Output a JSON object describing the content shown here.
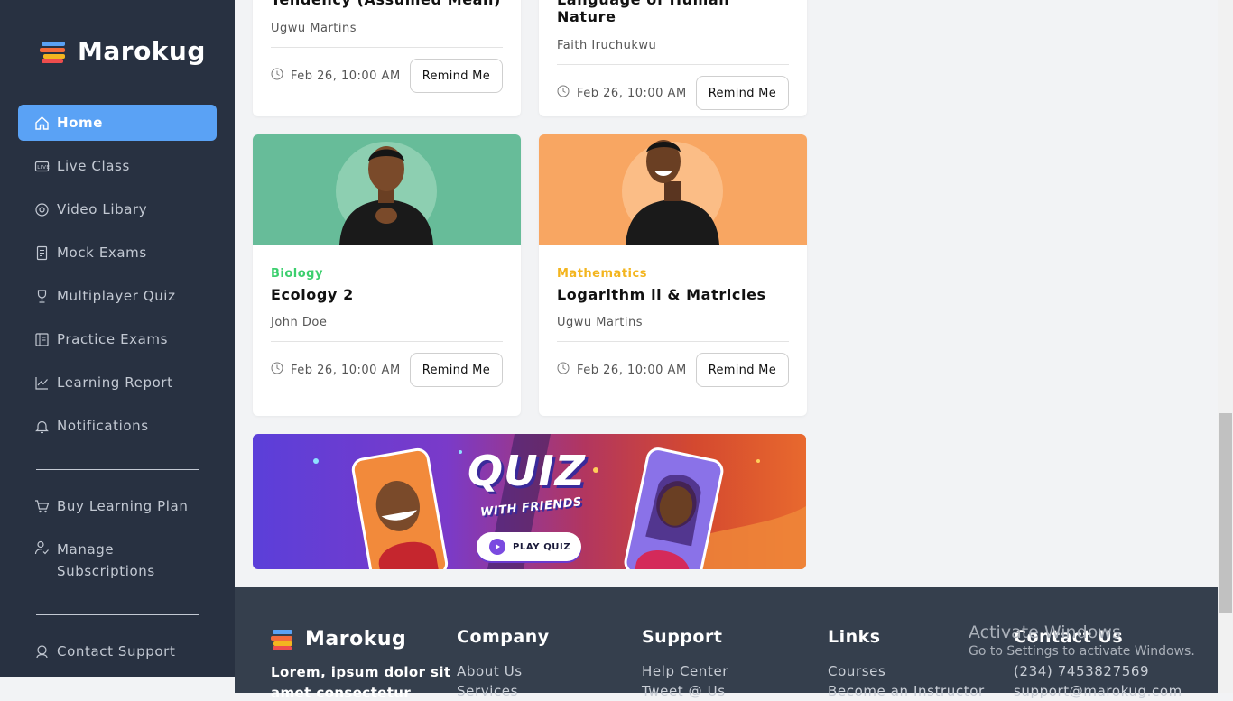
{
  "brand": {
    "name": "Marokug"
  },
  "sidebar": {
    "items": [
      {
        "label": "Home",
        "icon": "home-icon"
      },
      {
        "label": "Live Class",
        "icon": "live-icon"
      },
      {
        "label": "Video Libary",
        "icon": "video-icon"
      },
      {
        "label": "Mock Exams",
        "icon": "document-icon"
      },
      {
        "label": "Multiplayer Quiz",
        "icon": "trophy-icon"
      },
      {
        "label": "Practice Exams",
        "icon": "book-icon"
      },
      {
        "label": "Learning Report",
        "icon": "chart-icon"
      },
      {
        "label": "Notifications",
        "icon": "bell-icon"
      }
    ],
    "secondary": [
      {
        "label": "Buy Learning Plan",
        "icon": "cart-icon"
      },
      {
        "label": "Manage Subscriptions",
        "icon": "subscription-icon"
      }
    ],
    "support": {
      "label": "Contact Support",
      "icon": "headset-icon"
    },
    "active_color": "#5aa2f5"
  },
  "classes": [
    {
      "title": "Tendency (Assumed Mean)",
      "author": "Ugwu Martins",
      "date": "Feb 26, 10:00 AM",
      "button": "Remind Me"
    },
    {
      "title": "Language of Human Nature",
      "author": "Faith Iruchukwu",
      "date": "Feb 26, 10:00 AM",
      "button": "Remind Me"
    },
    {
      "category": "Biology",
      "category_color": "#3ccf6e",
      "title": "Ecology 2",
      "author": "John Doe",
      "date": "Feb 26, 10:00 AM",
      "button": "Remind Me",
      "image_bg": "#67bc99"
    },
    {
      "category": "Mathematics",
      "category_color": "#f3b51f",
      "title": "Logarithm ii & Matricies",
      "author": "Ugwu Martins",
      "date": "Feb 26, 10:00 AM",
      "button": "Remind Me",
      "image_bg": "#f8a662"
    }
  ],
  "banner": {
    "title": "QUIZ",
    "subtitle": "WITH FRIENDS",
    "cta": "PLAY QUIZ"
  },
  "footer": {
    "brand": "Marokug",
    "about": "Lorem, ipsum dolor sit",
    "about_line2": "amet consectetur",
    "company": {
      "heading": "Company",
      "links": [
        "About Us",
        "Services"
      ]
    },
    "support": {
      "heading": "Support",
      "links": [
        "Help Center",
        "Tweet @ Us"
      ]
    },
    "links": {
      "heading": "Links",
      "links": [
        "Courses",
        "Become an Instructor"
      ]
    },
    "contact": {
      "heading": "Contact Us",
      "phone": "(234) 7453827569",
      "email": "support@marokug.com"
    }
  },
  "watermark": {
    "line1": "Activate Windows",
    "line2": "Go to Settings to activate Windows."
  }
}
